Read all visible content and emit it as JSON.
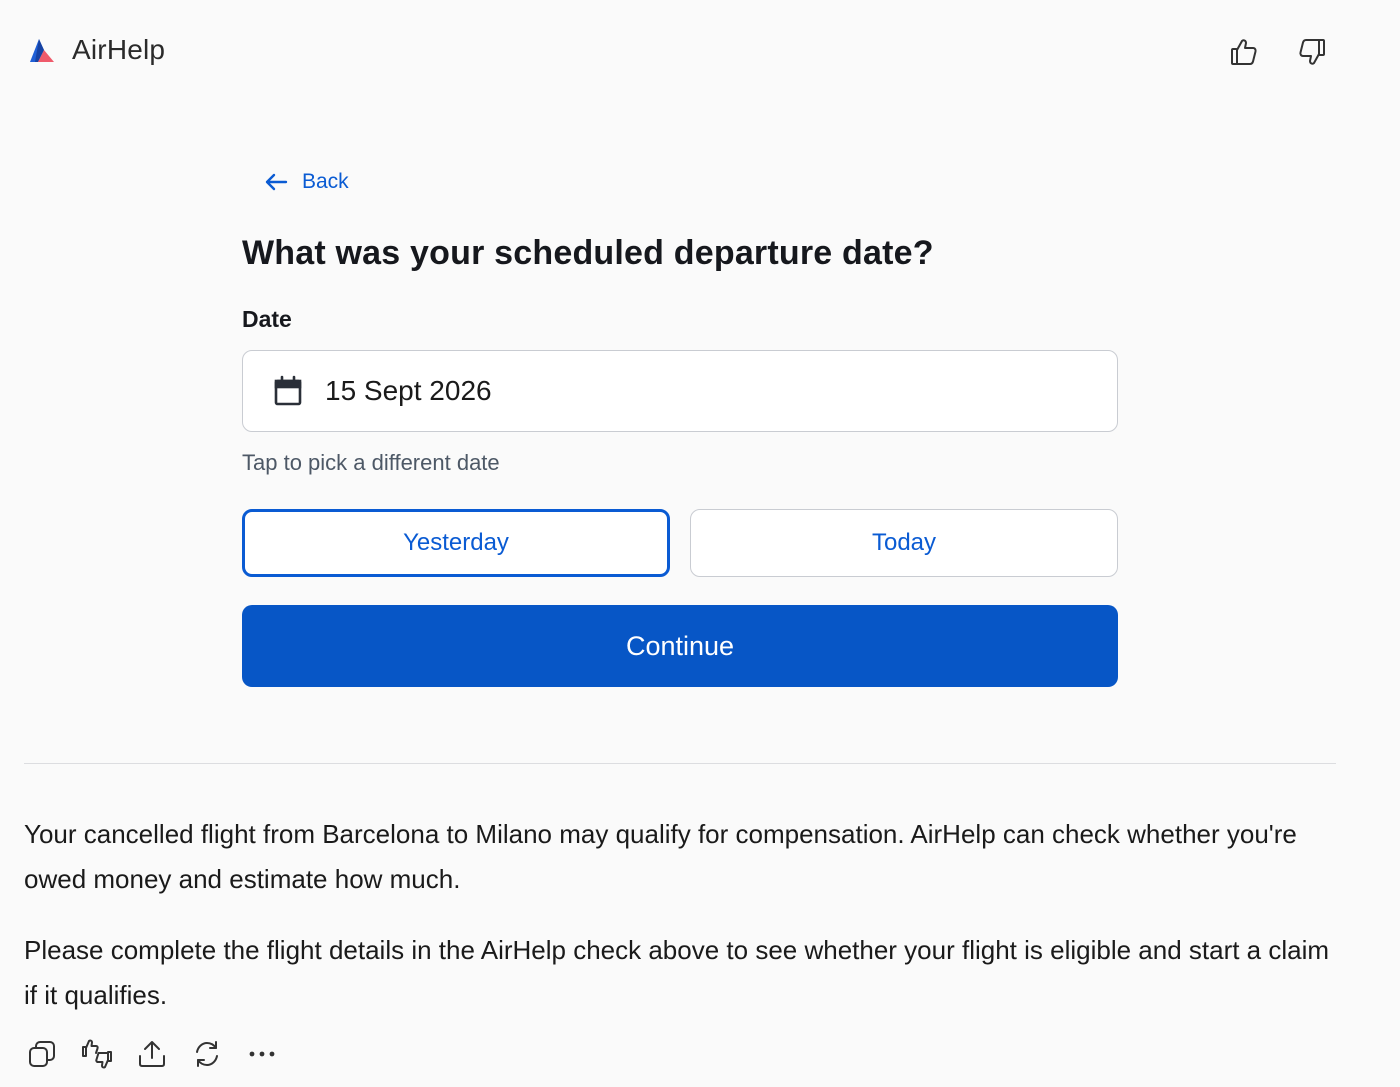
{
  "header": {
    "app_name": "AirHelp"
  },
  "widget": {
    "back_label": "Back",
    "question": "What was your scheduled departure date?",
    "date_label": "Date",
    "date_value": "15 Sept 2026",
    "hint": "Tap to pick a different date",
    "yesterday_label": "Yesterday",
    "today_label": "Today",
    "continue_label": "Continue"
  },
  "message": {
    "paragraphs": [
      "Your cancelled flight from Barcelona to Milano may qualify for compensation. AirHelp can check whether you're owed money and estimate how much.",
      "Please complete the flight details in the AirHelp check above to see whether your flight is eligible and start a claim if it qualifies."
    ]
  },
  "icons": {
    "logo": "airhelp-logo-icon",
    "header_actions": [
      "thumbs-up-icon",
      "thumbs-down-icon"
    ],
    "back": "arrow-left-icon",
    "date_field": "calendar-icon",
    "message_actions": [
      "copy-icon",
      "feedback-icon",
      "share-icon",
      "regenerate-icon",
      "more-icon"
    ]
  },
  "colors": {
    "accent": "#0a5bd3",
    "primary_button": "#0756c6",
    "background": "#fafafa",
    "logo_blue": "#1f5fd6",
    "logo_red": "#ef5a6b"
  }
}
